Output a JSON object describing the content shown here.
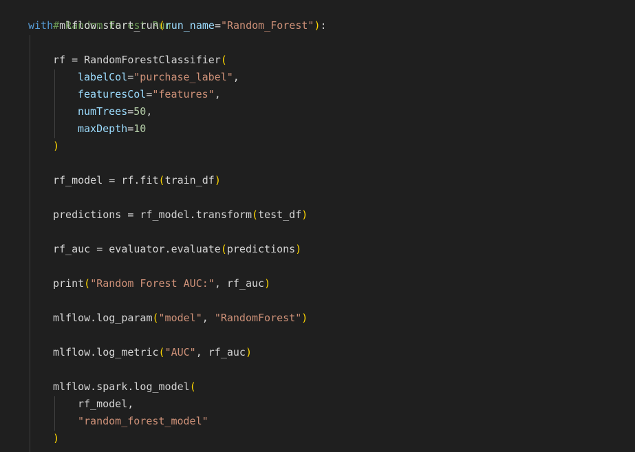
{
  "editor": {
    "language": "python",
    "theme": {
      "background": "#1f1f1f",
      "comment": "#6a9955",
      "keyword": "#569cd6",
      "identifier": "#d4d4d4",
      "parameter": "#9cdcfe",
      "string": "#ce9178",
      "number": "#b5cea8",
      "bracket": "#ffd700"
    },
    "lines": {
      "l1": {
        "comment": "# Random Forest Run"
      },
      "l2": {
        "kw": "with",
        "a": " mlflow.start_run",
        "p1": "(",
        "param": "run_name",
        "eq": "=",
        "str": "\"Random_Forest\"",
        "p2": ")",
        "colon": ":"
      },
      "l4": {
        "a": "rf = RandomForestClassifier",
        "p1": "("
      },
      "l5": {
        "param": "labelCol",
        "eq": "=",
        "str": "\"purchase_label\"",
        "comma": ","
      },
      "l6": {
        "param": "featuresCol",
        "eq": "=",
        "str": "\"features\"",
        "comma": ","
      },
      "l7": {
        "param": "numTrees",
        "eq": "=",
        "num": "50",
        "comma": ","
      },
      "l8": {
        "param": "maxDepth",
        "eq": "=",
        "num": "10"
      },
      "l9": {
        "p2": ")"
      },
      "l11": {
        "a": "rf_model = rf.fit",
        "p1": "(",
        "b": "train_df",
        "p2": ")"
      },
      "l13": {
        "a": "predictions = rf_model.transform",
        "p1": "(",
        "b": "test_df",
        "p2": ")"
      },
      "l15": {
        "a": "rf_auc = evaluator.evaluate",
        "p1": "(",
        "b": "predictions",
        "p2": ")"
      },
      "l17": {
        "a": "print",
        "p1": "(",
        "str": "\"Random Forest AUC:\"",
        "b": ", rf_auc",
        "p2": ")"
      },
      "l19": {
        "a": "mlflow.log_param",
        "p1": "(",
        "str1": "\"model\"",
        "b": ", ",
        "str2": "\"RandomForest\"",
        "p2": ")"
      },
      "l21": {
        "a": "mlflow.log_metric",
        "p1": "(",
        "str": "\"AUC\"",
        "b": ", rf_auc",
        "p2": ")"
      },
      "l23": {
        "a": "mlflow.spark.log_model",
        "p1": "("
      },
      "l24": {
        "a": "rf_model,"
      },
      "l25": {
        "str": "\"random_forest_model\""
      },
      "l26": {
        "p2": ")"
      }
    }
  }
}
